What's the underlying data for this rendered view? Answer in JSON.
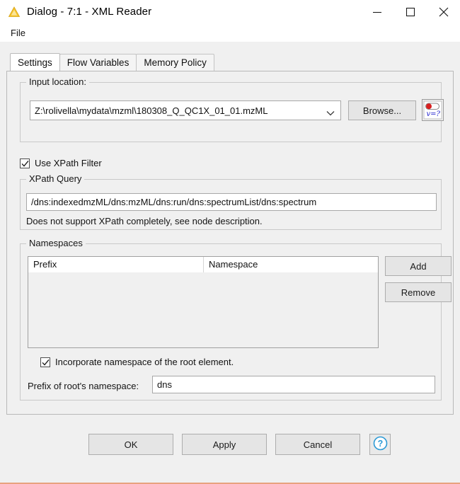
{
  "window": {
    "title": "Dialog - 7:1 - XML Reader",
    "icon": "knime-node-triangle-icon",
    "minimize_label": "–",
    "maximize_label": "□",
    "close_label": "✕"
  },
  "menubar": {
    "items": [
      {
        "label": "File",
        "name": "menu-file"
      }
    ]
  },
  "tabs": [
    {
      "label": "Settings",
      "active": true
    },
    {
      "label": "Flow Variables",
      "active": false
    },
    {
      "label": "Memory Policy",
      "active": false
    }
  ],
  "input_location": {
    "legend": "Input location:",
    "path_value": "Z:\\rolivella\\mydata\\mzml\\180308_Q_QC1X_01_01.mzML",
    "path_placeholder": "",
    "browse_label": "Browse...",
    "flow_variable_icon": "flow-variable-icon",
    "flow_variable_text": "v=?"
  },
  "xpath": {
    "use_filter_label": "Use XPath Filter",
    "use_filter_checked": true,
    "query_legend": "XPath Query",
    "query_value": "/dns:indexedmzML/dns:mzML/dns:run/dns:spectrumList/dns:spectrum",
    "query_placeholder": "",
    "hint": "Does not support XPath completely, see node description."
  },
  "namespaces": {
    "legend": "Namespaces",
    "columns": [
      "Prefix",
      "Namespace"
    ],
    "rows": [],
    "add_label": "Add",
    "remove_label": "Remove",
    "incorporate_label": "Incorporate namespace of the root element.",
    "incorporate_checked": true,
    "prefix_label": "Prefix of root's namespace:",
    "prefix_value": "dns",
    "prefix_placeholder": ""
  },
  "footer": {
    "ok_label": "OK",
    "apply_label": "Apply",
    "cancel_label": "Cancel",
    "help_icon": "help-question-icon"
  },
  "colors": {
    "window_bg": "#f0f0f0",
    "titlebar_bg": "#ffffff",
    "accent_border": "#e8a27f",
    "icon_yellow": "#f2c230",
    "help_blue": "#2c9ad6",
    "flowvar_red": "#cf2020",
    "flowvar_blue": "#2020c0"
  }
}
